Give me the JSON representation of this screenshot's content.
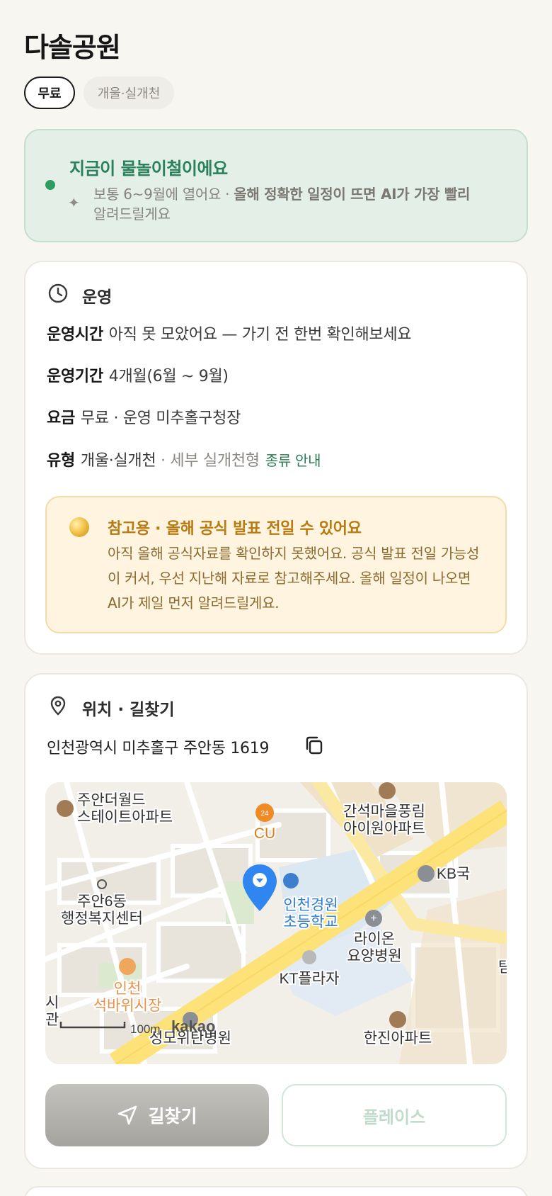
{
  "page": {
    "title": "다솔공원",
    "chips": {
      "price": "무료",
      "type": "개울·실개천"
    }
  },
  "season_banner": {
    "title": "지금이 물놀이철이에요",
    "desc_plain": "보통 6~9월에 열어요 · ",
    "desc_bold": "올해 정확한 일정이 뜨면 AI가 가장 빨리",
    "desc_tail": "알려드릴게요",
    "dot_color": "#2e9d5f"
  },
  "operations": {
    "section_title": "운영",
    "hours_key": "운영시간",
    "hours_value": "아직 못 모았어요 — 가기 전 한번 확인해보세요",
    "period_key": "운영기간",
    "period_value": "4개월(6월 ~ 9월)",
    "fee_key": "요금",
    "fee_value": "무료 · 운영 미추홀구청장",
    "type_key": "유형",
    "type_value": "개울·실개천",
    "type_sub": " · 세부 실개천형",
    "type_link": "종류 안내",
    "notice_title": "참고용 · 올해 공식 발표 전일 수 있어요",
    "notice_body": "아직 올해 공식자료를 확인하지 못했어요. 공식 발표 전일 가능성이 커서, 우선 지난해 자료로 참고해주세요. 올해 일정이 나오면 AI가 제일 먼저 알려드릴게요."
  },
  "location": {
    "section_title": "위치 · 길찾기",
    "address": "인천광역시 미추홀구 주안동 1619",
    "map": {
      "labels": {
        "apt1_line1": "주안더월드",
        "apt1_line2": "스테이트아파트",
        "cu": "CU",
        "apt2_line1": "간석마을풍림",
        "apt2_line2": "아이원아파트",
        "kb": "KB국",
        "office_line1": "주안6동",
        "office_line2": "행정복지센터",
        "school_line1": "인천경원",
        "school_line2": "초등학교",
        "hospital_line1": "라이온",
        "hospital_line2": "요양병원",
        "market_line1": "인천",
        "market_line2": "석바위시장",
        "kt": "KT플라자",
        "scale": "100m",
        "brand": "kakao",
        "bottom_apt": "한진아파트",
        "bottom_hospital": "성모위탄병원",
        "edge_left1": "시",
        "edge_left2": "관",
        "edge_right": "탐",
        "cu_badge": "24"
      }
    },
    "directions_label": "길찾기",
    "place_label": "플레이스"
  },
  "colors": {
    "accent_green": "#27815a",
    "notice_gold": "#b77b12",
    "pin_blue": "#2f86f0",
    "road_yellow": "#fde27a"
  }
}
